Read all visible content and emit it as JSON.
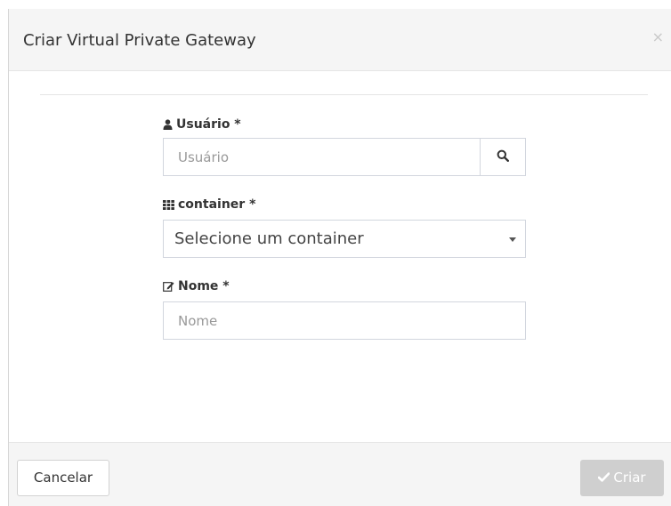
{
  "modal": {
    "title": "Criar Virtual Private Gateway",
    "close_symbol": "×"
  },
  "form": {
    "user": {
      "label": "Usuário *",
      "icon": "user-icon",
      "placeholder": "Usuário",
      "value": "",
      "search_icon": "search-icon"
    },
    "container": {
      "label": "container *",
      "icon": "grid-icon",
      "selected": "Selecione um container"
    },
    "name": {
      "label": "Nome *",
      "icon": "edit-icon",
      "placeholder": "Nome",
      "value": ""
    }
  },
  "footer": {
    "cancel_label": "Cancelar",
    "create_label": "Criar",
    "create_icon": "check-icon",
    "create_enabled": false
  },
  "colors": {
    "header_bg": "#f5f5f5",
    "border": "#d2d6de",
    "disabled_button": "#cfcfcf"
  }
}
